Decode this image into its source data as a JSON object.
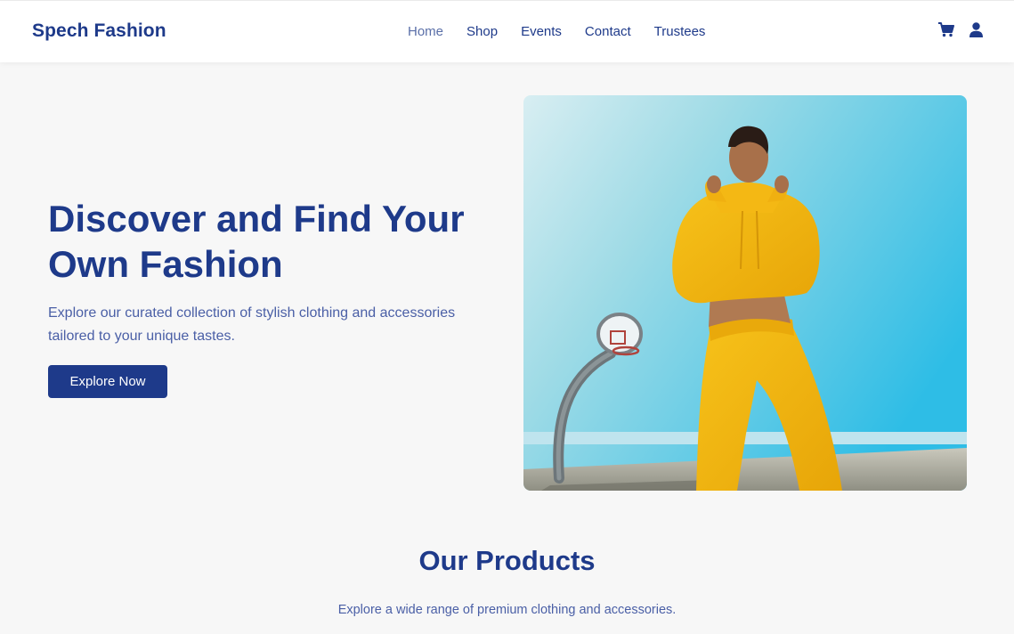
{
  "navbar": {
    "brand": "Spech Fashion",
    "links": [
      {
        "label": "Home",
        "active": true
      },
      {
        "label": "Shop",
        "active": false
      },
      {
        "label": "Events",
        "active": false
      },
      {
        "label": "Contact",
        "active": false
      },
      {
        "label": "Trustees",
        "active": false
      }
    ],
    "icons": [
      "cart-icon",
      "user-icon"
    ]
  },
  "hero": {
    "title": "Discover and Find Your Own Fashion",
    "description": "Explore our curated collection of stylish clothing and accessories tailored to your unique tastes.",
    "button_label": "Explore Now",
    "image": "woman-in-yellow-tracksuit-basketball-court"
  },
  "products": {
    "title": "Our Products",
    "subtitle": "Explore a wide range of premium clothing and accessories."
  },
  "colors": {
    "primary": "#1e3a8a",
    "nav_active": "#5a6fa8",
    "background": "#f7f7f7"
  }
}
